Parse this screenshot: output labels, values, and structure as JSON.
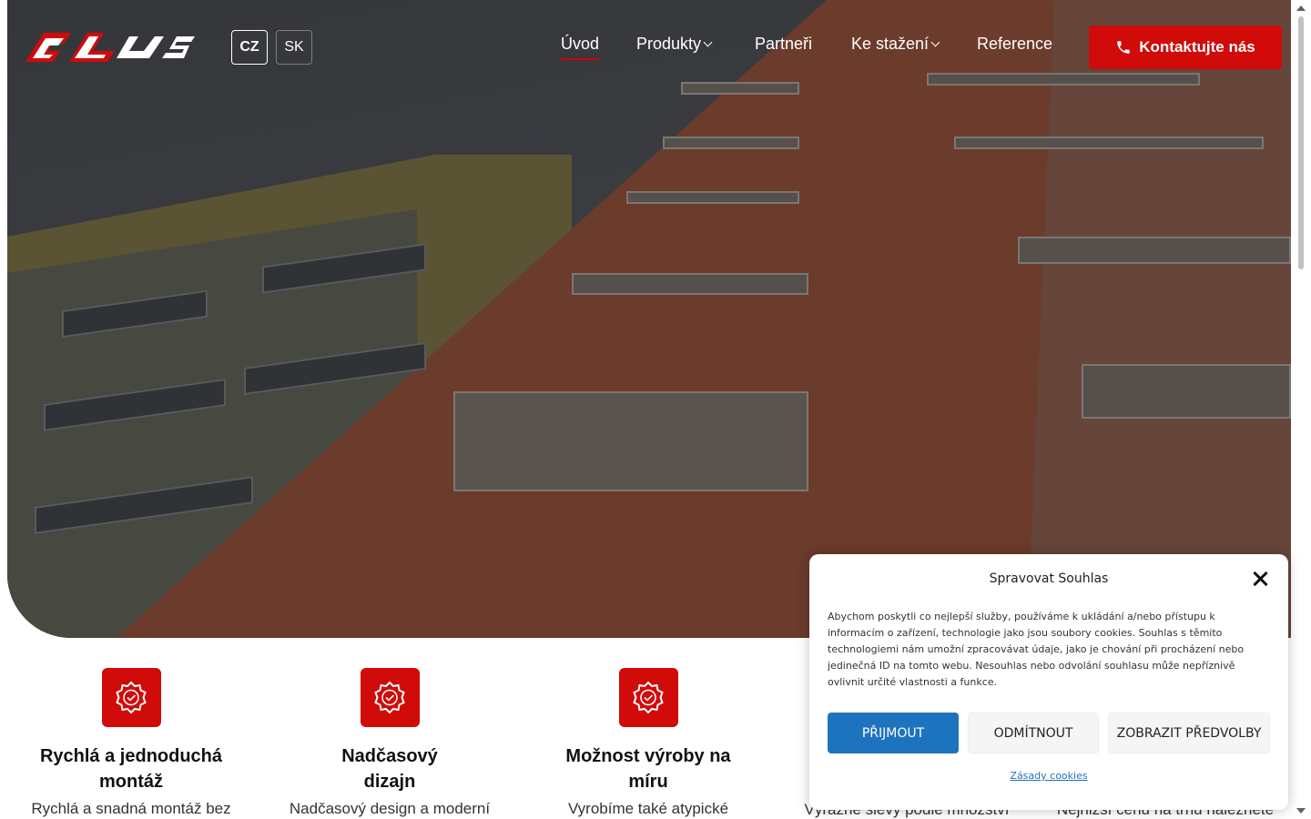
{
  "header": {
    "logo_alt": "ALUS",
    "languages": [
      {
        "code": "CZ",
        "active": true
      },
      {
        "code": "SK",
        "active": false
      }
    ],
    "nav": [
      {
        "label": "Úvod",
        "active": true,
        "dropdown": false
      },
      {
        "label": "Produkty",
        "active": false,
        "dropdown": true
      },
      {
        "label": "Partneři",
        "active": false,
        "dropdown": false
      },
      {
        "label": "Ke stažení",
        "active": false,
        "dropdown": true
      },
      {
        "label": "Reference",
        "active": false,
        "dropdown": false
      }
    ],
    "cta_label": "Kontaktujte nás",
    "cta_icon": "phone-icon"
  },
  "features": [
    {
      "title_line1": "Rychlá a jednoduchá",
      "title_line2": "montáž",
      "desc": "Rychlá a snadná montáž bez"
    },
    {
      "title_line1": "Nadčasový",
      "title_line2": "dizajn",
      "desc": "Nadčasový design a moderní"
    },
    {
      "title_line1": "Možnost výroby na",
      "title_line2": "míru",
      "desc": "Vyrobíme také atypické"
    },
    {
      "title_line1": "",
      "title_line2": "",
      "desc": "Výrazné slevy podle množství"
    },
    {
      "title_line1": "",
      "title_line2": "",
      "desc": "Nejnižší cenu na trhu naleznete"
    }
  ],
  "cookie": {
    "title": "Spravovat Souhlas",
    "text": "Abychom poskytli co nejlepší služby, používáme k ukládání a/nebo přístupu k informacím o zařízení, technologie jako jsou soubory cookies. Souhlas s těmito technologiemi nám umožní zpracovávat údaje, jako je chování při procházení nebo jedinečná ID na tomto webu. Nesouhlas nebo odvolání souhlasu může nepříznivě ovlivnit určité vlastnosti a funkce.",
    "accept": "PŘIJMOUT",
    "deny": "ODMÍTNOUT",
    "prefs": "ZOBRAZIT PŘEDVOLBY",
    "policy": "Zásady cookies"
  },
  "colors": {
    "brand_red": "#d10a0a",
    "accept_blue": "#1e73be"
  }
}
